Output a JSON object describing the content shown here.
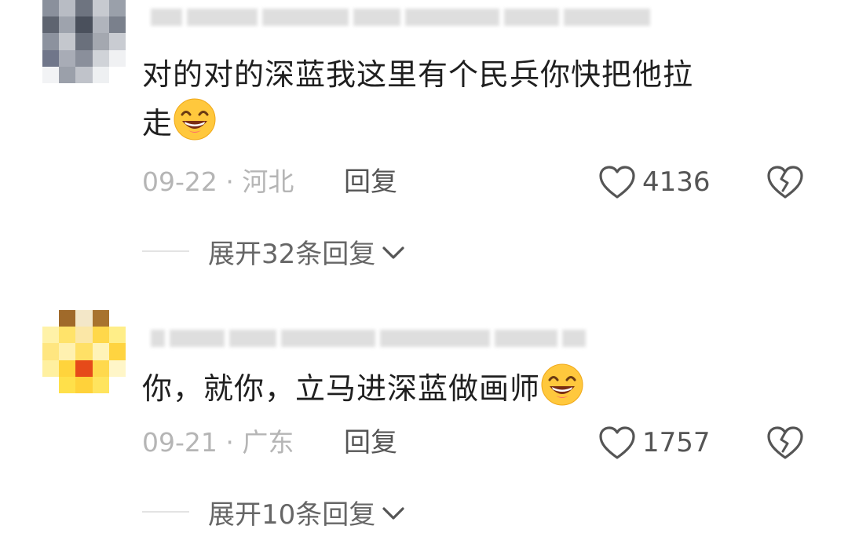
{
  "comments": [
    {
      "text_line1": "对的对的深蓝我这里有个民兵你快把他拉",
      "text_line2": "走",
      "emoji": "grinning-emoji",
      "date": "09-22",
      "separator": "·",
      "location": "河北",
      "reply_label": "回复",
      "likes": "4136",
      "expand_label": "展开32条回复"
    },
    {
      "text_line1": "你，就你，立马进深蓝做画师",
      "emoji": "grinning-emoji",
      "date": "09-21",
      "separator": "·",
      "location": "广东",
      "reply_label": "回复",
      "likes": "1757",
      "expand_label": "展开10条回复"
    }
  ],
  "colors": {
    "meta_gray": "#b5b5b5",
    "action_gray": "#555555",
    "text_dark": "#1f1f1f"
  }
}
